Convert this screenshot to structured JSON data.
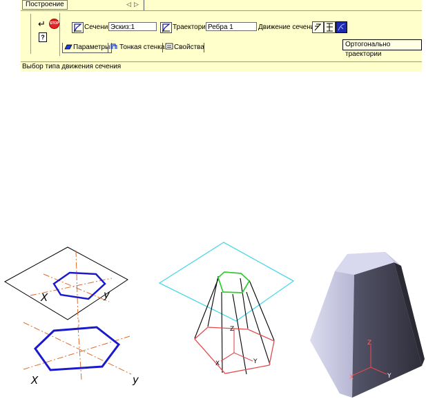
{
  "toolbar": {
    "tab_label": "Построение",
    "nav_left": "◁",
    "nav_right": "▷",
    "enter_glyph": "↵",
    "stop_label": "STOP",
    "help_glyph": "?"
  },
  "fields": {
    "section_label": "Сечение",
    "section_value": "Эскиз:1",
    "trajectory_label": "Траектория",
    "trajectory_value": "Ребра 1",
    "motion_label": "Движение сечения"
  },
  "tooltip": "Ортогонально траектории",
  "tabs": [
    {
      "label": "Параметры"
    },
    {
      "label": "Тонкая стенка"
    },
    {
      "label": "Свойства"
    }
  ],
  "status": "Выбор типа движения сечения",
  "figure1": {
    "upper_x": "X",
    "upper_y": "y",
    "lower_x": "X",
    "lower_y": "y"
  },
  "figure2": {
    "axis_z": "Z",
    "axis_x": "X",
    "axis_y": "Y"
  },
  "figure3": {
    "axis_z": "Z",
    "axis_x": "X",
    "axis_y": "Y"
  },
  "colors": {
    "panel_bg": "#ffffcc",
    "hexagon": "#1a1acc",
    "axis": "#e06a2a",
    "plane_cyan": "#4ad8e8",
    "hex_green": "#33cc33",
    "hex_red": "#e24a4a",
    "solid_light": "#cfcfe8",
    "solid_dark": "#4a4a5c"
  }
}
